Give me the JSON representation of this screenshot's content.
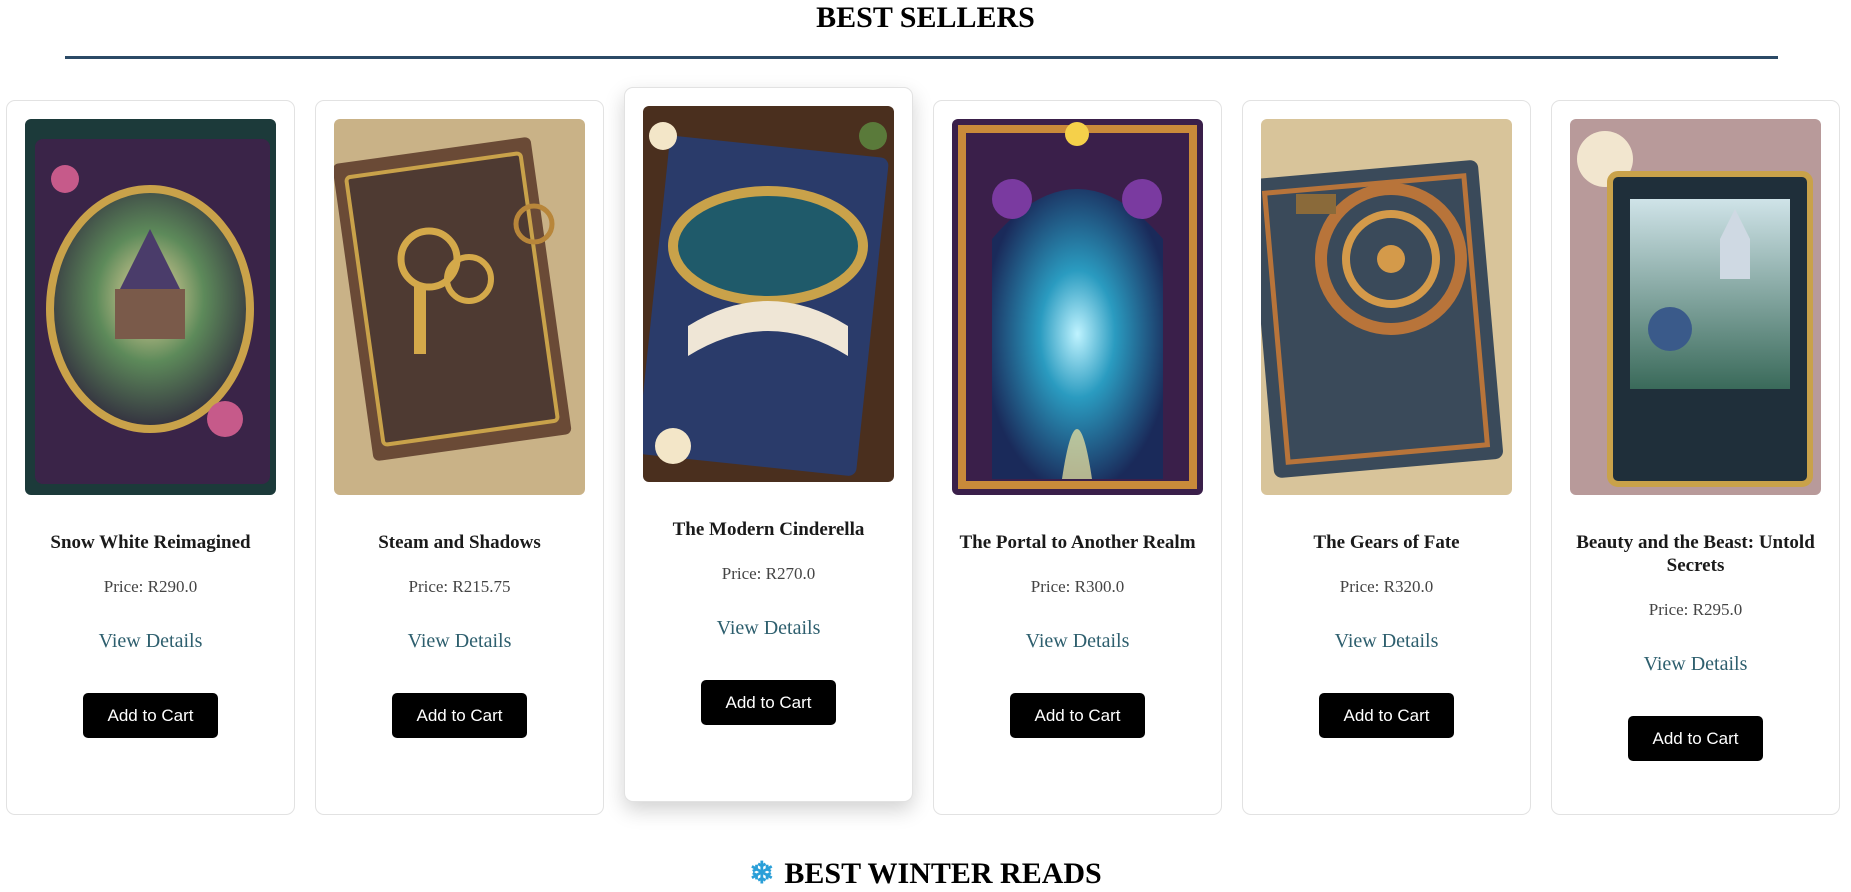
{
  "sections": {
    "best_sellers": "BEST SELLERS",
    "winter": "BEST WINTER READS"
  },
  "colors": {
    "accent_rule": "#2b4a66",
    "link": "#2e5f6e",
    "button_bg": "#000000",
    "snowflake": "#2a9fd8"
  },
  "icons": {
    "winter_section": "snowflake-icon"
  },
  "books": [
    {
      "title": "Snow White Reimagined",
      "price": "Price: R290.0",
      "details_label": "View Details",
      "cart_label": "Add to Cart"
    },
    {
      "title": "Steam and Shadows",
      "price": "Price: R215.75",
      "details_label": "View Details",
      "cart_label": "Add to Cart"
    },
    {
      "title": "The Modern Cinderella",
      "price": "Price: R270.0",
      "details_label": "View Details",
      "cart_label": "Add to Cart"
    },
    {
      "title": "The Portal to Another Realm",
      "price": "Price: R300.0",
      "details_label": "View Details",
      "cart_label": "Add to Cart"
    },
    {
      "title": "The Gears of Fate",
      "price": "Price: R320.0",
      "details_label": "View Details",
      "cart_label": "Add to Cart"
    },
    {
      "title": "Beauty and the Beast: Untold Secrets",
      "price": "Price: R295.0",
      "details_label": "View Details",
      "cart_label": "Add to Cart"
    }
  ]
}
